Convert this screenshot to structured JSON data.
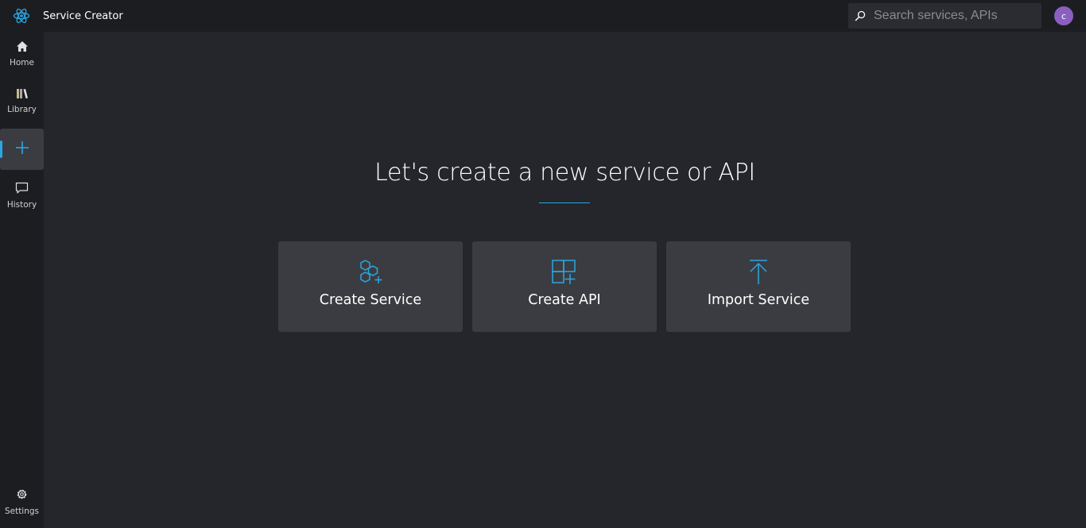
{
  "app": {
    "title": "Service Creator",
    "logo_icon": "react-atom-icon",
    "accent_color": "#2aa7e2"
  },
  "search": {
    "placeholder": "Search services, APIs",
    "value": ""
  },
  "user": {
    "avatar_initial": "c",
    "avatar_color": "#8b5fbf"
  },
  "sidebar": {
    "items": [
      {
        "label": "Home",
        "icon": "home-icon"
      },
      {
        "label": "Library",
        "icon": "library-icon"
      },
      {
        "label": "",
        "icon": "plus-icon",
        "active": true
      },
      {
        "label": "History",
        "icon": "chat-bubble-icon"
      }
    ],
    "settings": {
      "label": "Settings",
      "icon": "gear-icon"
    }
  },
  "main": {
    "headline": "Let's create a new service or API",
    "cards": [
      {
        "label": "Create Service",
        "icon": "hexagons-plus-icon"
      },
      {
        "label": "Create API",
        "icon": "grid-plus-icon"
      },
      {
        "label": "Import Service",
        "icon": "upload-arrow-icon"
      }
    ]
  }
}
